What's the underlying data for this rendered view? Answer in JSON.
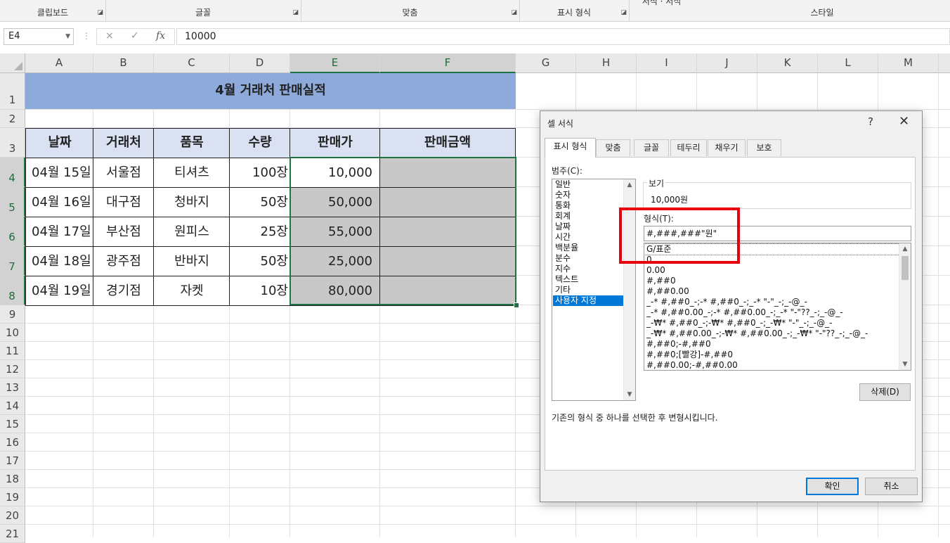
{
  "ribbon": {
    "groups": [
      "클립보드",
      "글꼴",
      "맞춤",
      "표시 형식",
      "서식 · 서식",
      "스타일"
    ]
  },
  "formula_bar": {
    "name_box": "E4",
    "cancel_icon": "×",
    "enter_icon": "✓",
    "fx_icon": "fx",
    "value": "10000"
  },
  "sheet": {
    "columns": [
      "A",
      "B",
      "C",
      "D",
      "E",
      "F",
      "G",
      "H",
      "I",
      "J",
      "K",
      "L",
      "M"
    ],
    "rows": [
      "1",
      "2",
      "3",
      "4",
      "5",
      "6",
      "7",
      "8",
      "9",
      "10",
      "11",
      "12",
      "13",
      "14",
      "15",
      "16",
      "17",
      "18",
      "19",
      "20",
      "21"
    ],
    "title": "4월 거래처 판매실적",
    "headers": [
      "날짜",
      "거래처",
      "품목",
      "수량",
      "판매가",
      "판매금액"
    ],
    "data": [
      [
        "04월 15일",
        "서울점",
        "티셔츠",
        "100장",
        "10,000",
        ""
      ],
      [
        "04월 16일",
        "대구점",
        "청바지",
        "50장",
        "50,000",
        ""
      ],
      [
        "04월 17일",
        "부산점",
        "원피스",
        "25장",
        "55,000",
        ""
      ],
      [
        "04월 18일",
        "광주점",
        "반바지",
        "50장",
        "25,000",
        ""
      ],
      [
        "04월 19일",
        "경기점",
        "자켓",
        "10장",
        "80,000",
        ""
      ]
    ],
    "selected_range": "E4:F8",
    "selection_color": "#217346",
    "title_fill": "#8eaadb",
    "header_fill": "#d9e1f2",
    "selected_fill": "#c8c8c8"
  },
  "dialog": {
    "title": "셀 서식",
    "help": "?",
    "close": "✕",
    "tabs": [
      "표시 형식",
      "맞춤",
      "글꼴",
      "테두리",
      "채우기",
      "보호"
    ],
    "active_tab": "표시 형식",
    "category_label": "범주(C):",
    "categories": [
      "일반",
      "숫자",
      "통화",
      "회계",
      "날짜",
      "시간",
      "백분율",
      "분수",
      "지수",
      "텍스트",
      "기타",
      "사용자 지정"
    ],
    "selected_category": "사용자 지정",
    "sample_label": "보기",
    "sample_value": "10,000원",
    "type_label": "형식(T):",
    "type_value": "#,###,###\"원\"",
    "formats": [
      "G/표준",
      "0",
      "0.00",
      "#,##0",
      "#,##0.00",
      "_-* #,##0_-;-* #,##0_-;_-* \"-\"_-;_-@_-",
      "_-* #,##0.00_-;-* #,##0.00_-;_-* \"-\"??_-;_-@_-",
      "_-₩* #,##0_-;-₩* #,##0_-;_-₩* \"-\"_-;_-@_-",
      "_-₩* #,##0.00_-;-₩* #,##0.00_-;_-₩* \"-\"??_-;_-@_-",
      "#,##0;-#,##0",
      "#,##0;[빨강]-#,##0",
      "#,##0.00;-#,##0.00"
    ],
    "delete_button": "삭제(D)",
    "description": "기존의 형식 중 하나를 선택한 후 변형시킵니다.",
    "ok_button": "확인",
    "cancel_button": "취소",
    "highlight_color": "#e8000b"
  }
}
